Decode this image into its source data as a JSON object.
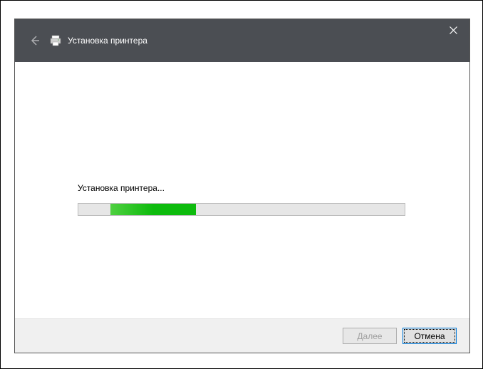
{
  "window": {
    "title": "Установка принтера"
  },
  "content": {
    "status_text": "Установка принтера..."
  },
  "progress": {
    "left_pct": 9.8,
    "width_pct": 26
  },
  "buttons": {
    "next_prefix": "Д",
    "next_rest": "алее",
    "cancel": "Отмена"
  }
}
